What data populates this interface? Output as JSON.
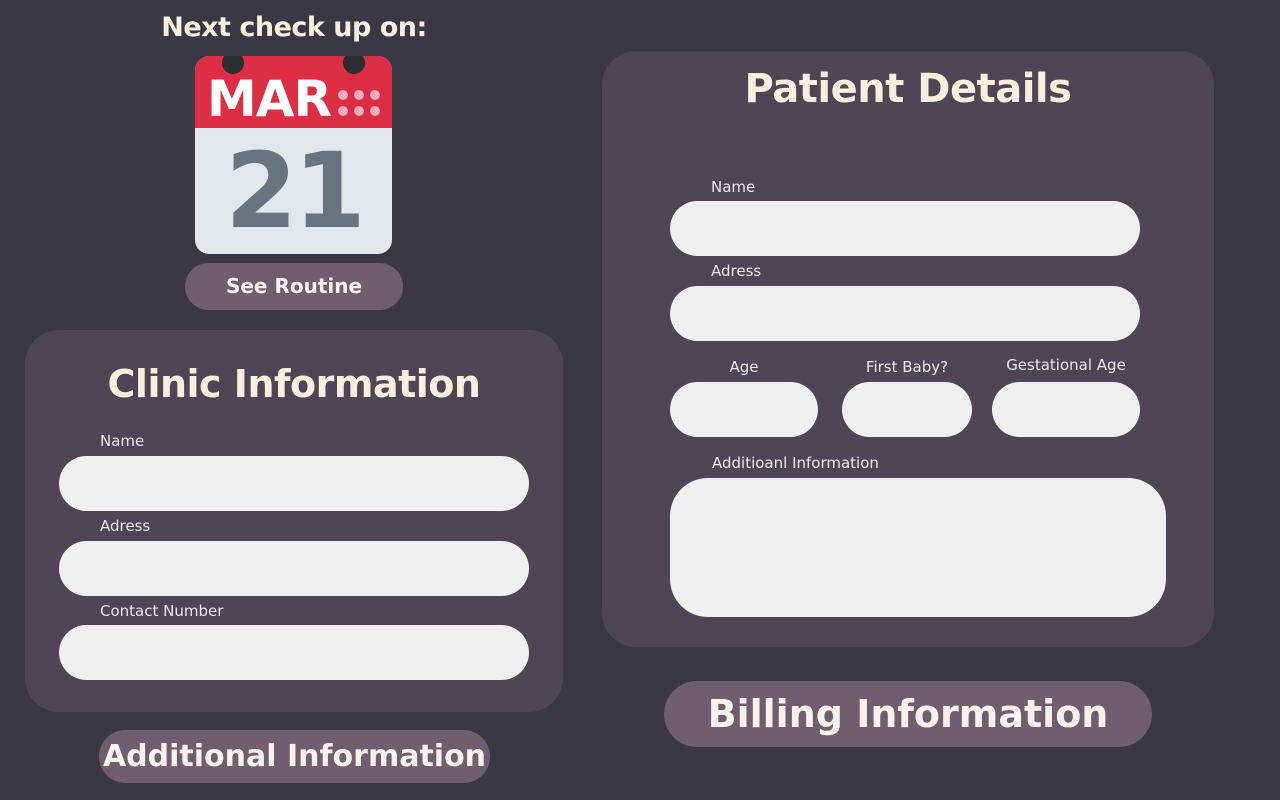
{
  "checkup": {
    "heading": "Next check up on:",
    "calendar": {
      "month": "MAR",
      "day": "21",
      "icon": "calendar-icon"
    },
    "routine_button": "See Routine"
  },
  "clinic": {
    "title": "Clinic Information",
    "fields": [
      {
        "label": "Name",
        "value": ""
      },
      {
        "label": "Adress",
        "value": ""
      },
      {
        "label": "Contact Number",
        "value": ""
      }
    ]
  },
  "patient": {
    "title": "Patient Details",
    "fields": {
      "name": {
        "label": "Name",
        "value": ""
      },
      "address": {
        "label": "Adress",
        "value": ""
      },
      "age": {
        "label": "Age",
        "value": ""
      },
      "first_baby": {
        "label": "First Baby?",
        "value": ""
      },
      "gestational_age": {
        "label": "Gestational Age",
        "value": ""
      },
      "additional": {
        "label": "Additioanl Information",
        "value": ""
      }
    }
  },
  "buttons": {
    "additional_information": "Additional Information",
    "billing_information": "Billing Information"
  },
  "colors": {
    "background": "#3a3845",
    "panel": "#504457",
    "button": "#705e70",
    "field": "#efefef",
    "heading_text": "#f8efdc",
    "calendar_red": "#dd2e44",
    "calendar_gray": "#66757f"
  }
}
